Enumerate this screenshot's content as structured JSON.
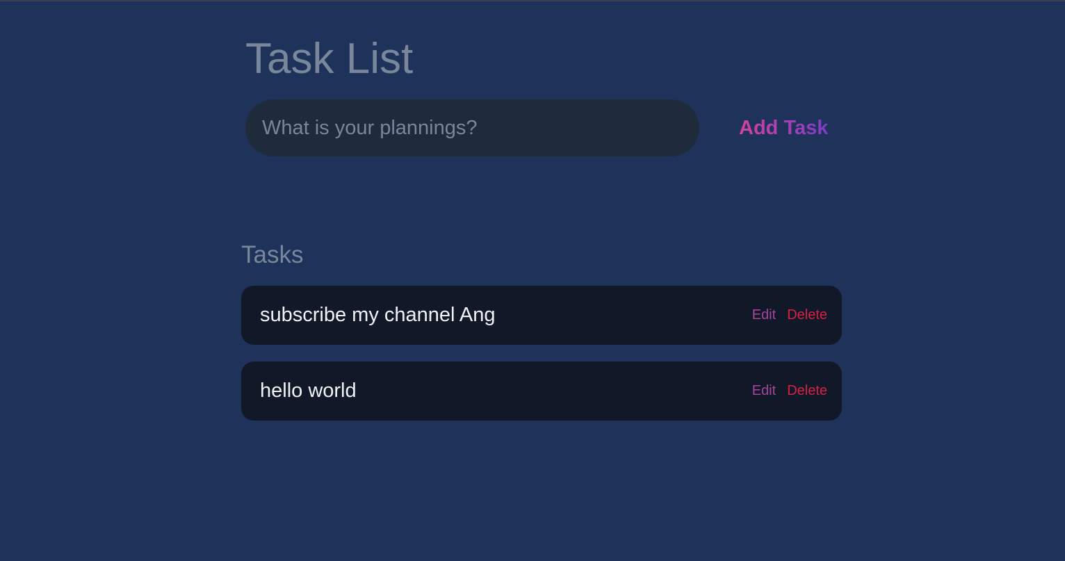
{
  "header": {
    "title": "Task List"
  },
  "form": {
    "placeholder": "What is your plannings?",
    "value": "",
    "add_label": "Add Task"
  },
  "tasks_section": {
    "heading": "Tasks",
    "items": [
      {
        "text": "subscribe my channel Ang",
        "edit_label": "Edit",
        "delete_label": "Delete"
      },
      {
        "text": "hello world",
        "edit_label": "Edit",
        "delete_label": "Delete"
      }
    ]
  },
  "colors": {
    "background": "#1f3259",
    "accent_pink": "#d6449c",
    "accent_purple": "#7a3bc9",
    "delete_red": "#dc1f45",
    "card_bg": "#111827"
  }
}
